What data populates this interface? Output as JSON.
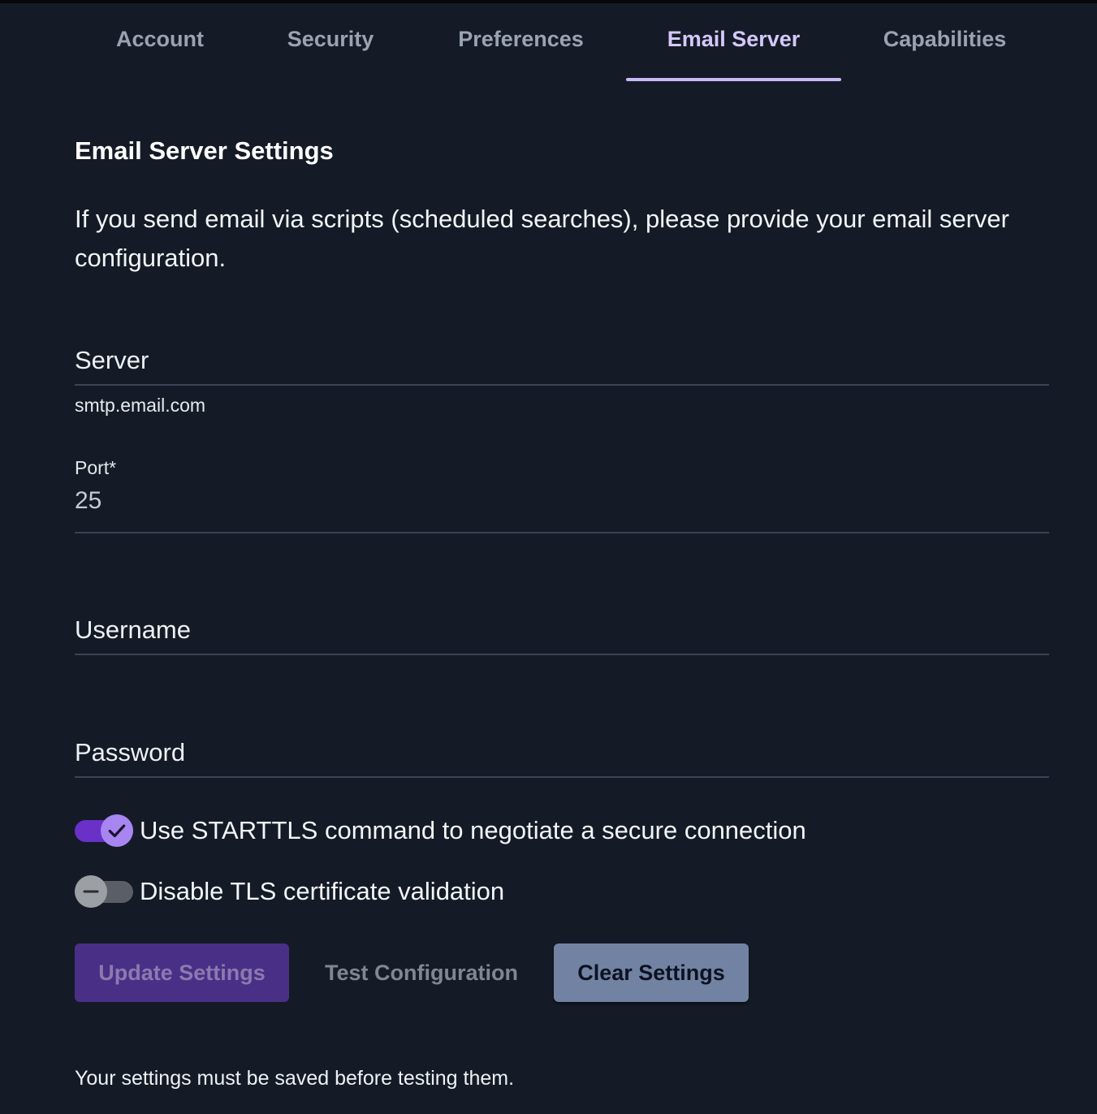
{
  "tabs": [
    {
      "label": "Account",
      "active": false
    },
    {
      "label": "Security",
      "active": false
    },
    {
      "label": "Preferences",
      "active": false
    },
    {
      "label": "Email Server",
      "active": true
    },
    {
      "label": "Capabilities",
      "active": false
    }
  ],
  "section": {
    "title": "Email Server Settings",
    "description": "If you send email via scripts (scheduled searches), please provide your email server configuration."
  },
  "fields": {
    "server": {
      "label": "Server",
      "helper": "smtp.email.com",
      "value": ""
    },
    "port": {
      "label": "Port*",
      "value": "25"
    },
    "username": {
      "label": "Username",
      "value": ""
    },
    "password": {
      "label": "Password",
      "value": ""
    }
  },
  "toggles": {
    "starttls": {
      "label": "Use STARTTLS command to negotiate a secure connection",
      "checked": true
    },
    "disable_tls_validation": {
      "label": "Disable TLS certificate validation",
      "checked": false
    }
  },
  "buttons": {
    "update": "Update Settings",
    "test": "Test Configuration",
    "clear": "Clear Settings"
  },
  "footnote": "Your settings must be saved before testing them.",
  "colors": {
    "background": "#141b26",
    "accent": "#c9b8f7",
    "toggle_on": "#6a31c9",
    "primary_button": "#4a2f86",
    "secondary_button": "#7282a3"
  }
}
